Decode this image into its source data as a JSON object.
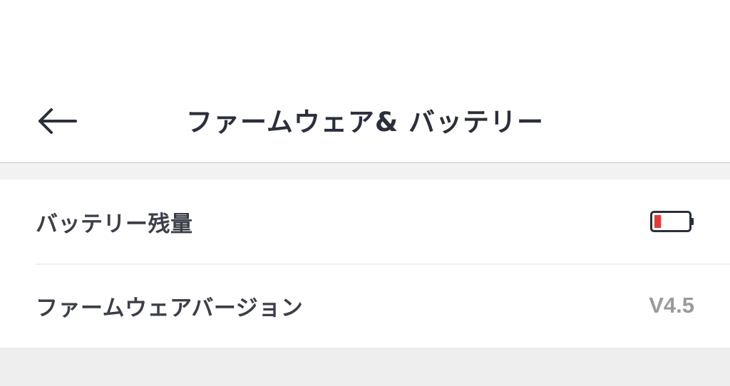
{
  "header": {
    "title": "ファームウェア& バッテリー",
    "back_icon": "arrow-left-icon"
  },
  "settings": {
    "battery": {
      "label": "バッテリー残量",
      "icon": "battery-low-icon",
      "level_percent": 20,
      "fill_color": "#e53935"
    },
    "firmware": {
      "label": "ファームウェアバージョン",
      "value": "V4.5"
    }
  }
}
